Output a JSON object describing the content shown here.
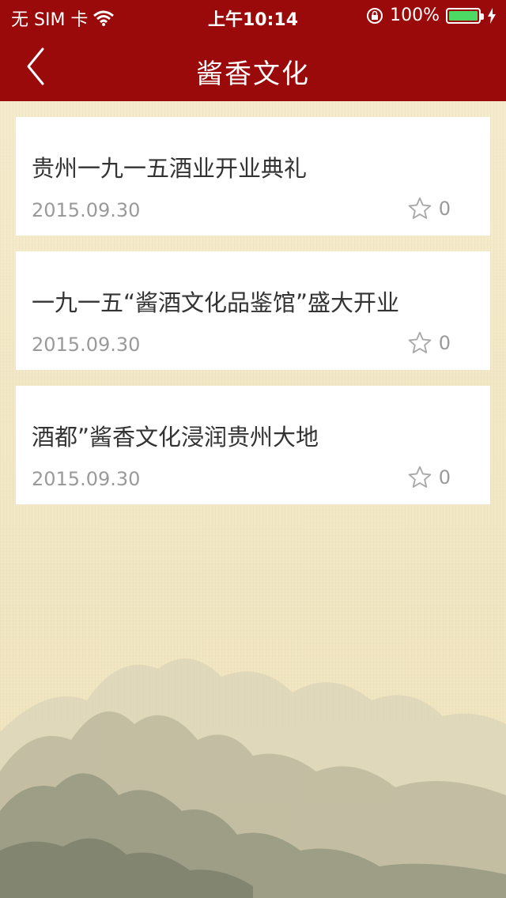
{
  "status_bar": {
    "carrier": "无 SIM 卡",
    "time": "上午10:14",
    "battery_percent": "100%",
    "battery_level": 1.0,
    "battery_color": "#4cd964"
  },
  "nav": {
    "title": "酱香文化",
    "back_icon": "chevron-left-icon",
    "background_color": "#9a0a0a"
  },
  "articles": [
    {
      "title": "贵州一九一五酒业开业典礼",
      "date": "2015.09.30",
      "favorites": "0"
    },
    {
      "title": "一九一五“酱酒文化品鉴馆”盛大开业",
      "date": "2015.09.30",
      "favorites": "0"
    },
    {
      "title": "酒都”酱香文化浸润贵州大地",
      "date": "2015.09.30",
      "favorites": "0"
    }
  ]
}
